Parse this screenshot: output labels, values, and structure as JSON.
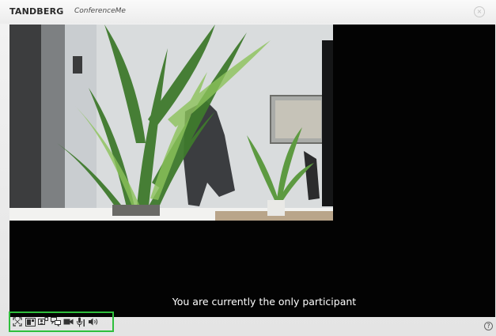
{
  "window": {
    "brand": "TANDBERG",
    "product": "ConferenceMe"
  },
  "video": {
    "status_message": "You are currently the only participant"
  },
  "toolbar": {
    "icons": [
      "fullscreen-icon",
      "layout-icon",
      "participants-icon",
      "chat-icon",
      "camera-icon",
      "microphone-icon",
      "speaker-icon"
    ]
  },
  "help": {
    "symbol": "?"
  },
  "colors": {
    "highlight": "#2fbf3c",
    "video_background": "#030303"
  }
}
